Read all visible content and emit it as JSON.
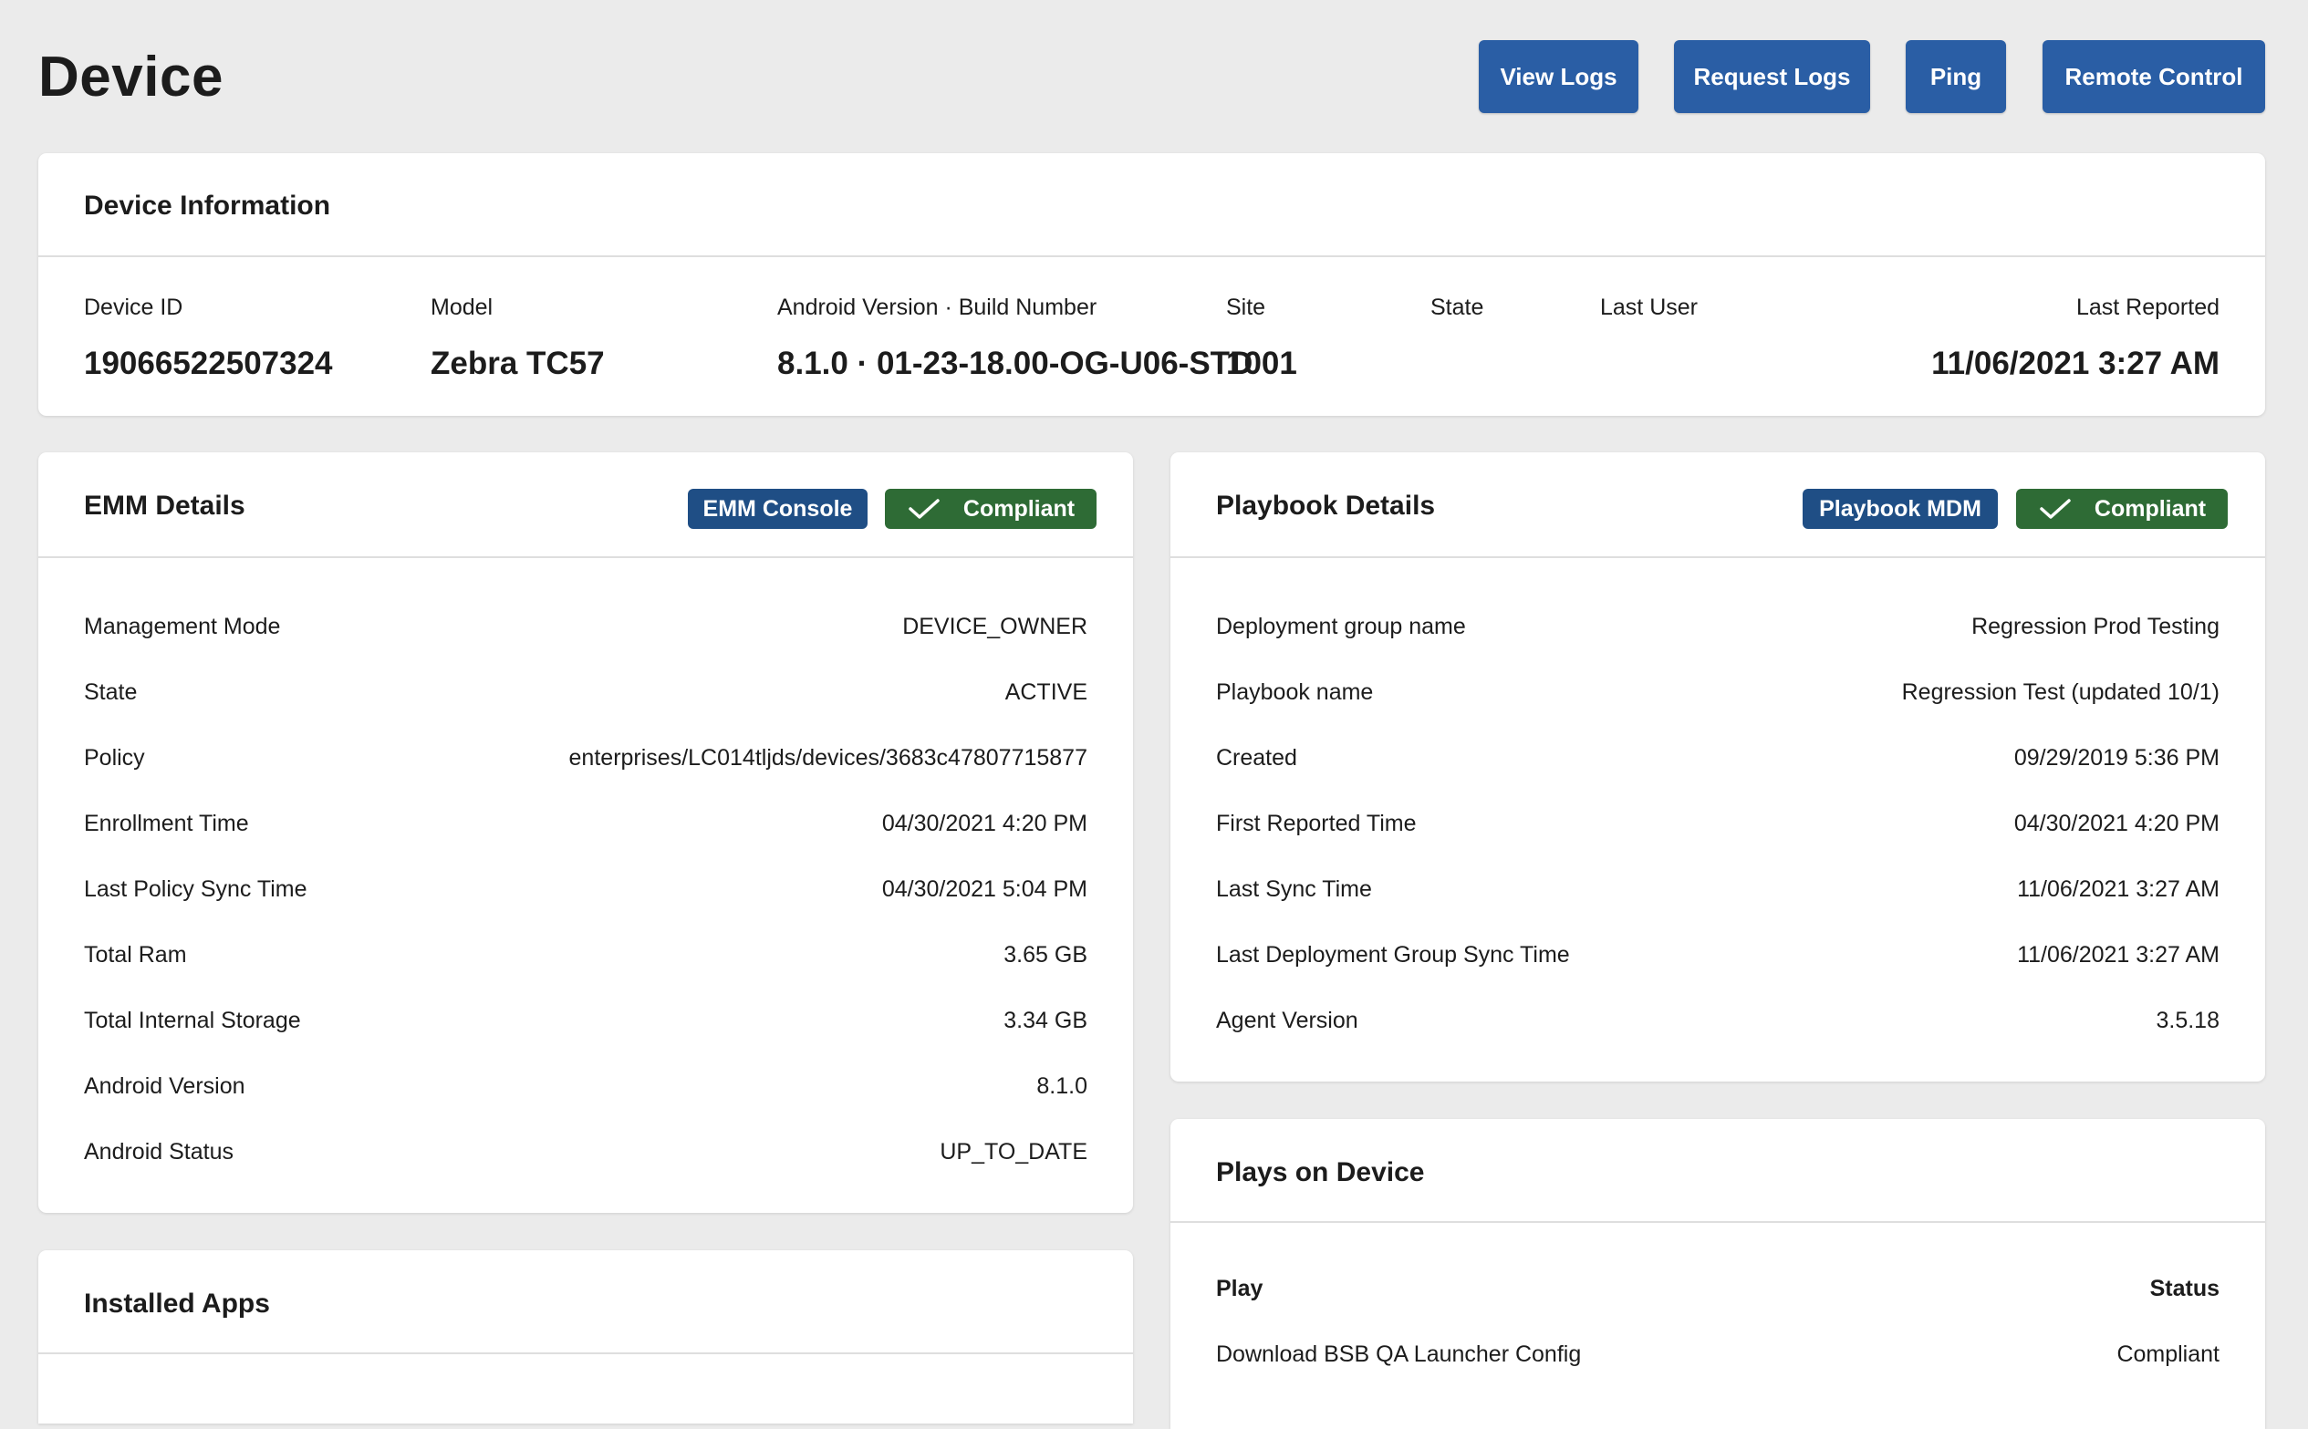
{
  "page": {
    "title": "Device"
  },
  "toolbar": {
    "view_logs": "View Logs",
    "request_logs": "Request Logs",
    "ping": "Ping",
    "remote_control": "Remote Control"
  },
  "device_info": {
    "title": "Device Information",
    "fields": [
      {
        "label": "Device ID",
        "value": "19066522507324"
      },
      {
        "label": "Model",
        "value": "Zebra TC57"
      },
      {
        "label": "Android Version · Build Number",
        "value": "8.1.0 · 01-23-18.00-OG-U06-STD"
      },
      {
        "label": "Site",
        "value": "1001"
      },
      {
        "label": "State",
        "value": ""
      },
      {
        "label": "Last User",
        "value": ""
      },
      {
        "label": "Last Reported",
        "value": "11/06/2021 3:27 AM"
      }
    ]
  },
  "emm": {
    "title": "EMM Details",
    "console_badge": "EMM Console",
    "status_badge": "Compliant",
    "rows": [
      {
        "label": "Management Mode",
        "value": "DEVICE_OWNER"
      },
      {
        "label": "State",
        "value": "ACTIVE"
      },
      {
        "label": "Policy",
        "value": "enterprises/LC014tljds/devices/3683c47807715877"
      },
      {
        "label": "Enrollment Time",
        "value": "04/30/2021 4:20 PM"
      },
      {
        "label": "Last Policy Sync Time",
        "value": "04/30/2021 5:04 PM"
      },
      {
        "label": "Total Ram",
        "value": "3.65 GB"
      },
      {
        "label": "Total Internal Storage",
        "value": "3.34 GB"
      },
      {
        "label": "Android Version",
        "value": "8.1.0"
      },
      {
        "label": "Android Status",
        "value": "UP_TO_DATE"
      }
    ]
  },
  "playbook": {
    "title": "Playbook Details",
    "mdm_badge": "Playbook MDM",
    "status_badge": "Compliant",
    "rows": [
      {
        "label": "Deployment group name",
        "value": "Regression Prod Testing"
      },
      {
        "label": "Playbook name",
        "value": "Regression Test (updated 10/1)"
      },
      {
        "label": "Created",
        "value": "09/29/2019 5:36 PM"
      },
      {
        "label": "First Reported Time",
        "value": "04/30/2021 4:20 PM"
      },
      {
        "label": "Last Sync Time",
        "value": "11/06/2021 3:27 AM"
      },
      {
        "label": "Last Deployment Group Sync Time",
        "value": "11/06/2021 3:27 AM"
      },
      {
        "label": "Agent Version",
        "value": "3.5.18"
      }
    ]
  },
  "installed_apps": {
    "title": "Installed Apps"
  },
  "plays": {
    "title": "Plays on Device",
    "columns": {
      "play": "Play",
      "status": "Status"
    },
    "rows": [
      {
        "play": "Download BSB QA Launcher Config",
        "status": "Compliant"
      }
    ]
  },
  "colors": {
    "primary_button": "#2a5ea5",
    "badge_blue": "#1f4e85",
    "badge_green": "#2e6b35",
    "background": "#ebebeb"
  }
}
